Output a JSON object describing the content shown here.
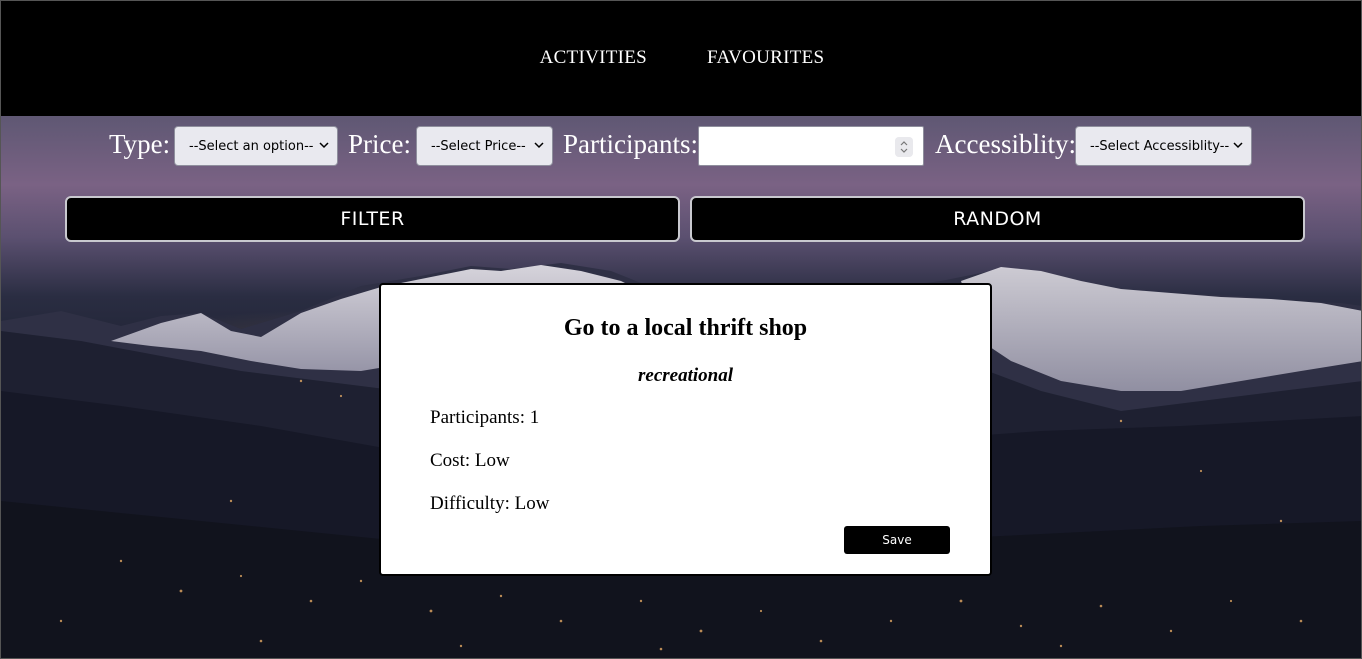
{
  "nav": {
    "activities": "ACTIVITIES",
    "favourites": "FAVOURITES"
  },
  "filters": {
    "type_label": "Type:",
    "type_selected": "--Select an option--",
    "price_label": "Price:",
    "price_selected": "--Select Price--",
    "participants_label": "Participants:",
    "participants_value": "",
    "accessibility_label": "Accessiblity:",
    "accessibility_selected": "--Select Accessiblity--"
  },
  "actions": {
    "filter": "FILTER",
    "random": "RANDOM"
  },
  "activity_card": {
    "title": "Go to a local thrift shop",
    "type": "recreational",
    "participants": "Participants: 1",
    "cost": "Cost: Low",
    "difficulty": "Difficulty: Low",
    "save": "Save"
  },
  "icons": {
    "select_arrow": "chevron-down-icon",
    "number_spinner": "spinner-icon"
  },
  "colors": {
    "nav_background": "#000000",
    "button_background": "#000000",
    "button_text": "#ffffff",
    "card_background": "#ffffff"
  }
}
